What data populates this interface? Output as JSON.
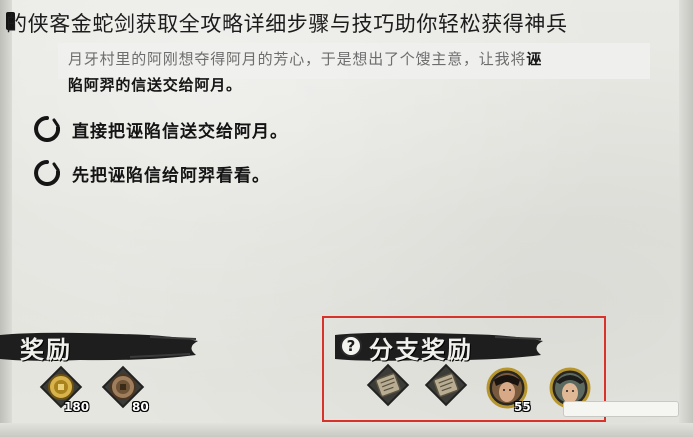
{
  "article": {
    "title": "的侠客金蛇剑获取全攻略详细步骤与技巧助你轻松获得神兵"
  },
  "dialog": {
    "description_line1_grey": "月牙村里的阿刚想夺得阿月的芳心，于是想出了个馊主意，让我将",
    "description_line1_bold": "诬",
    "description_line2": "陷阿羿的信送交给阿月。"
  },
  "choices": [
    {
      "label": "直接把诬陷信送交给阿月。"
    },
    {
      "label": "先把诬陷信给阿羿看看。"
    }
  ],
  "rewards": {
    "label": "奖励",
    "items": [
      {
        "icon": "gold-coin-icon",
        "count": "180"
      },
      {
        "icon": "copper-coin-icon",
        "count": "80"
      }
    ]
  },
  "branch_rewards": {
    "label": "分支奖励",
    "items": [
      {
        "icon": "scroll-icon"
      },
      {
        "icon": "scroll-icon"
      },
      {
        "icon": "portrait-male-warrior",
        "count": "55"
      },
      {
        "icon": "portrait-male-scholar"
      }
    ]
  },
  "colors": {
    "highlight": "#d8322c",
    "banner": "#1e1e1e",
    "text": "#141414"
  }
}
